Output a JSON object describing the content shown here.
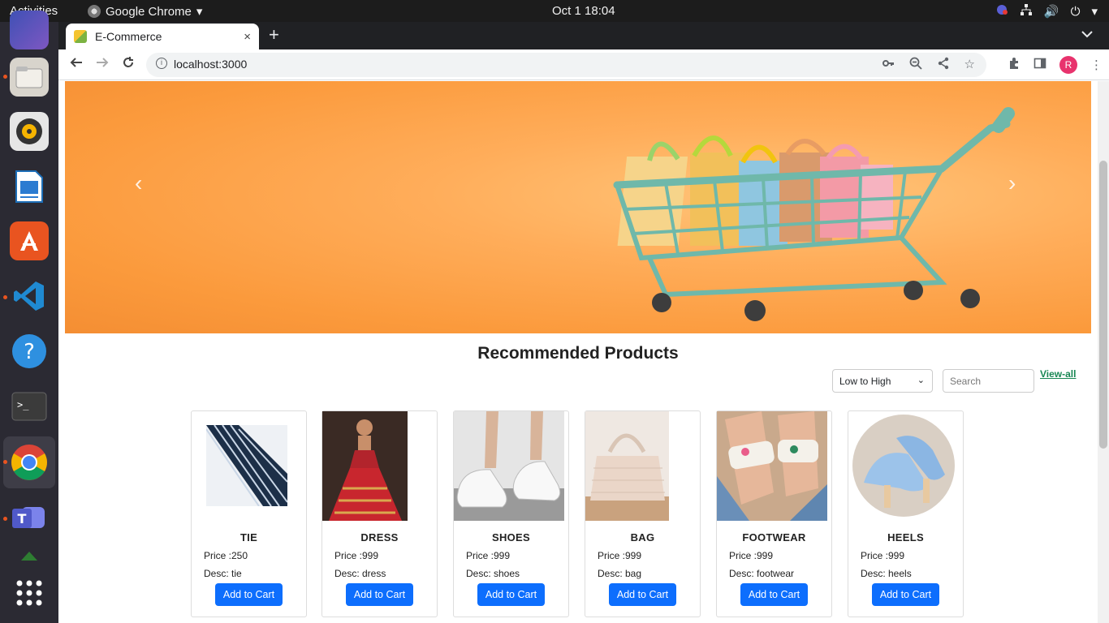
{
  "topbar": {
    "activities": "Activities",
    "app_name": "Google Chrome",
    "clock": "Oct 1  18:04",
    "tray_icons": [
      "network-icon",
      "volume-icon",
      "power-icon",
      "chevron-down-icon"
    ]
  },
  "dock": {
    "items": [
      "firefox",
      "files",
      "rhythmbox",
      "libreoffice-writer",
      "ubuntu-software",
      "vscode",
      "help",
      "terminal",
      "chrome",
      "teams",
      "show-apps"
    ]
  },
  "browser": {
    "tab_title": "E-Commerce",
    "tab_close": "×",
    "new_tab": "+",
    "url": "localhost:3000",
    "avatar_letter": "R"
  },
  "page": {
    "carousel": {
      "prev": "‹",
      "next": "›"
    },
    "heading": "Recommended Products",
    "sort_value": "Low to High",
    "search_placeholder": "Search",
    "view_all": "View-all",
    "products": [
      {
        "name": "TIE",
        "price": "Price :250",
        "desc": "Desc: tie",
        "button": "Add to Cart"
      },
      {
        "name": "DRESS",
        "price": "Price :999",
        "desc": "Desc: dress",
        "button": "Add to Cart"
      },
      {
        "name": "SHOES",
        "price": "Price :999",
        "desc": "Desc: shoes",
        "button": "Add to Cart"
      },
      {
        "name": "BAG",
        "price": "Price :999",
        "desc": "Desc: bag",
        "button": "Add to Cart"
      },
      {
        "name": "FOOTWEAR",
        "price": "Price :999",
        "desc": "Desc: footwear",
        "button": "Add to Cart"
      },
      {
        "name": "HEELS",
        "price": "Price :999",
        "desc": "Desc: heels",
        "button": "Add to Cart"
      }
    ]
  }
}
